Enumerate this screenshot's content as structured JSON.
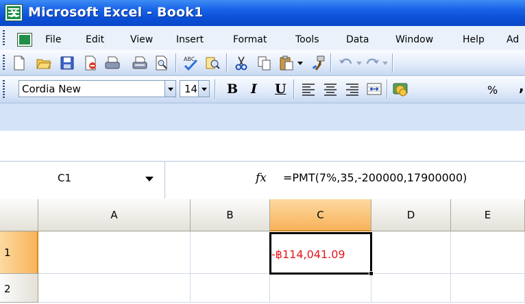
{
  "window": {
    "title": "Microsoft Excel - Book1"
  },
  "menu": {
    "items": [
      {
        "label": "File"
      },
      {
        "label": "Edit"
      },
      {
        "label": "View"
      },
      {
        "label": "Insert"
      },
      {
        "label": "Format"
      },
      {
        "label": "Tools"
      },
      {
        "label": "Data"
      },
      {
        "label": "Window"
      },
      {
        "label": "Help"
      },
      {
        "label": "Ad"
      }
    ]
  },
  "standard_toolbar": {
    "icons": [
      "new-icon",
      "open-icon",
      "save-icon",
      "permission-icon",
      "print-icon",
      "print-preview-icon",
      "spelling-icon",
      "research-icon",
      "cut-icon",
      "copy-icon",
      "paste-icon",
      "format-painter-icon",
      "undo-icon",
      "redo-icon"
    ]
  },
  "formatting_toolbar": {
    "font_name": "Cordia New",
    "font_size": "14",
    "bold": "B",
    "italic": "I",
    "underline": "U",
    "percent": "%",
    "comma": ","
  },
  "formula_bar": {
    "name_box": "C1",
    "fx_label": "fx",
    "formula": "=PMT(7%,35,-200000,17900000)"
  },
  "sheet": {
    "columns": [
      "A",
      "B",
      "C",
      "D",
      "E"
    ],
    "rows": [
      "1",
      "2"
    ],
    "selected_column": "C",
    "selected_row": "1",
    "cells": {
      "C1": "-฿114,041.09"
    },
    "colors": {
      "negative_value": "#e8131b",
      "selected_header": "#f8b35a"
    }
  }
}
